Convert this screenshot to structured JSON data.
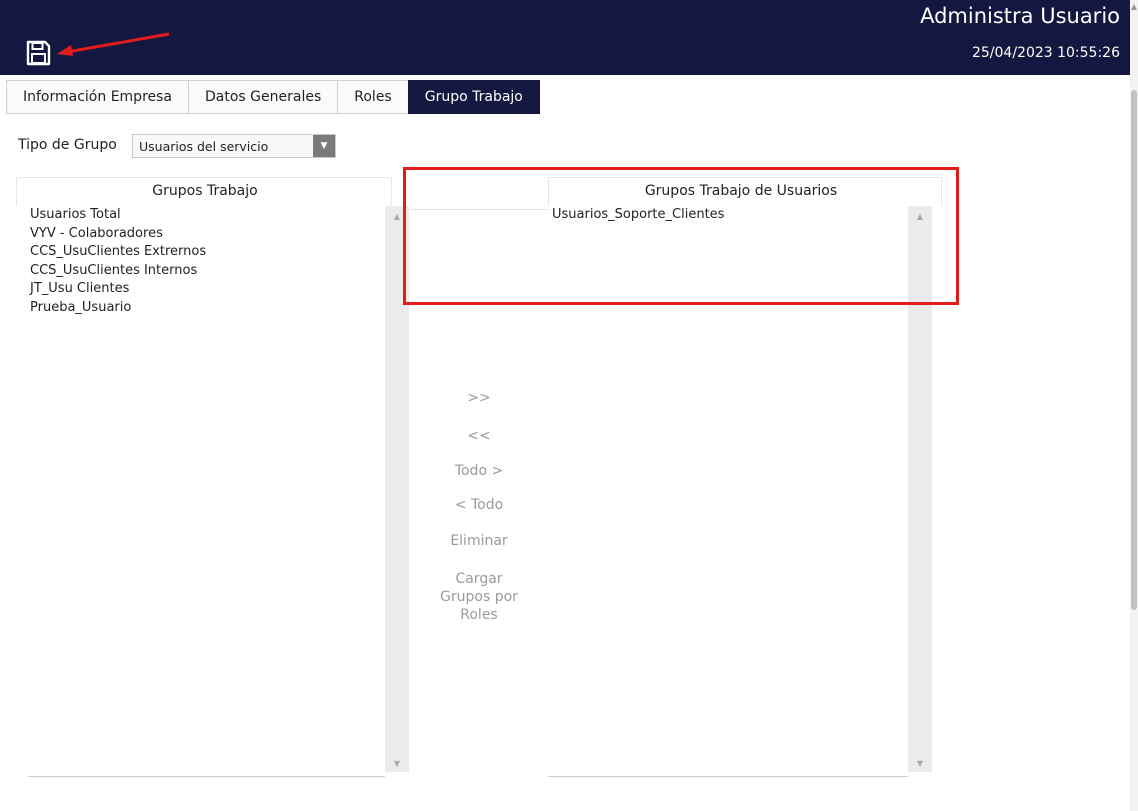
{
  "header": {
    "title": "Administra Usuario",
    "datetime": "25/04/2023 10:55:26",
    "save_icon": "floppy-disk-icon"
  },
  "tabs": [
    {
      "label": "Información Empresa",
      "active": false
    },
    {
      "label": "Datos Generales",
      "active": false
    },
    {
      "label": "Roles",
      "active": false
    },
    {
      "label": "Grupo Trabajo",
      "active": true
    }
  ],
  "filter": {
    "label": "Tipo de Grupo",
    "selected": "Usuarios del servicio"
  },
  "left_panel": {
    "title": "Grupos Trabajo",
    "items": [
      "Usuarios Total",
      "VYV - Colaboradores",
      "CCS_UsuClientes Extrernos",
      "CCS_UsuClientes Internos",
      "JT_Usu Clientes",
      "Prueba_Usuario"
    ]
  },
  "right_panel": {
    "title": "Grupos Trabajo de Usuarios",
    "items": [
      "Usuarios_Soporte_Clientes"
    ]
  },
  "actions": {
    "move_right": ">>",
    "move_left": "<<",
    "move_all_right": "Todo >",
    "move_all_left": "< Todo",
    "delete": "Eliminar",
    "load_groups": "Cargar Grupos por Roles"
  },
  "colors": {
    "header_bg": "#14173f",
    "active_tab_bg": "#14173f",
    "annotation": "#e51b1b",
    "action_text": "#9a9a9a"
  }
}
